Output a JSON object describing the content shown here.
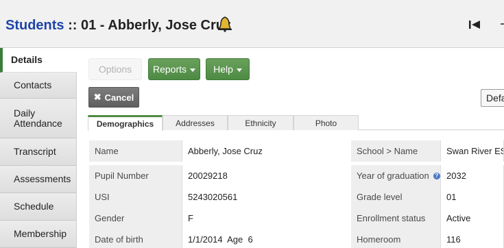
{
  "header": {
    "module": "Students",
    "separator": " :: ",
    "record": "01 - Abberly, Jose Cruz"
  },
  "sidebar": {
    "items": [
      {
        "label": "Details",
        "active": true
      },
      {
        "label": "Contacts"
      },
      {
        "label": "Daily Attendance"
      },
      {
        "label": "Transcript"
      },
      {
        "label": "Assessments"
      },
      {
        "label": "Schedule"
      },
      {
        "label": "Membership"
      }
    ]
  },
  "toolbar": {
    "options_label": "Options",
    "reports_label": "Reports",
    "help_label": "Help",
    "cancel_label": "Cancel",
    "default_label": "Defa"
  },
  "tabs": [
    {
      "label": "Demographics",
      "active": true
    },
    {
      "label": "Addresses"
    },
    {
      "label": "Ethnicity"
    },
    {
      "label": "Photo"
    }
  ],
  "fields": {
    "left": [
      {
        "label": "Name",
        "value": "Abberly, Jose Cruz"
      },
      {
        "label": "Pupil Number",
        "value": "20029218"
      },
      {
        "label": "USI",
        "value": "5243020561"
      },
      {
        "label": "Gender",
        "value": "F"
      },
      {
        "label": "Date of birth",
        "value": "1/1/2014  Age  6"
      }
    ],
    "right": [
      {
        "label": "School > Name",
        "value": "Swan River ES"
      },
      {
        "label": "Year of graduation",
        "value": "2032"
      },
      {
        "label": "Grade level",
        "value": "01"
      },
      {
        "label": "Enrollment status",
        "value": "Active"
      },
      {
        "label": "Homeroom",
        "value": "116"
      }
    ]
  },
  "colors": {
    "module_title": "#1f45a8",
    "green_button": "#4d8a43",
    "info_icon": "#4a78c4"
  },
  "icons": [
    "bell-icon",
    "first-record-icon",
    "info-icon",
    "close-icon",
    "caret-down-icon"
  ]
}
